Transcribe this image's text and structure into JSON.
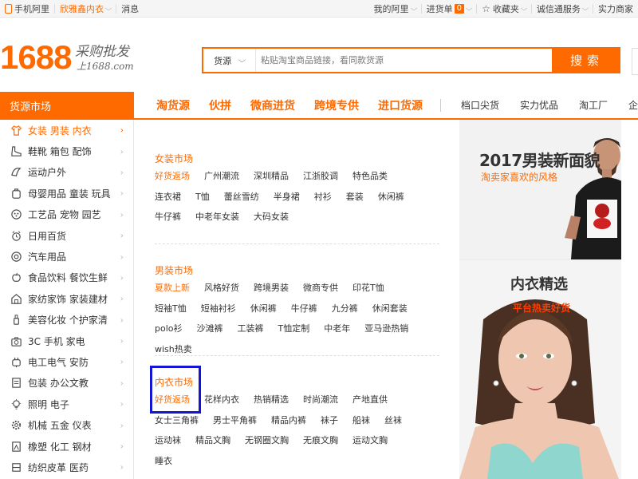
{
  "topbar": {
    "left": [
      {
        "label": "手机阿里",
        "icon": "phone-icon"
      },
      {
        "label": "欣雅鑫内衣",
        "dropdown": true,
        "orange": true
      },
      {
        "label": "消息"
      }
    ],
    "right": [
      {
        "label": "我的阿里",
        "dropdown": true
      },
      {
        "label": "进货单",
        "badge": "0",
        "dropdown": true
      },
      {
        "label": "收藏夹",
        "icon": "star-icon",
        "dropdown": true
      },
      {
        "label": "诚信通服务",
        "dropdown": true
      },
      {
        "label": "实力商家"
      }
    ]
  },
  "logo": {
    "number": "1688",
    "slogan": "采购批发",
    "url": "上1688.com"
  },
  "search": {
    "category": "货源",
    "placeholder": "粘贴淘宝商品链接，看同款货源",
    "button": "搜索"
  },
  "nav": {
    "category_title": "货源市场",
    "hot_links": [
      "淘货源",
      "伙拼",
      "微商进货",
      "跨境专供",
      "进口货源"
    ],
    "plain_links": [
      "档口尖货",
      "实力优品",
      "淘工厂",
      "企"
    ]
  },
  "sidebar": [
    {
      "label": "女装 男装 内衣",
      "icon": "shirt-icon",
      "active": true
    },
    {
      "label": "鞋靴 箱包 配饰",
      "icon": "shoe-icon"
    },
    {
      "label": "运动户外",
      "icon": "sport-icon"
    },
    {
      "label": "母婴用品 童装 玩具",
      "icon": "baby-icon"
    },
    {
      "label": "工艺品 宠物 园艺",
      "icon": "craft-icon"
    },
    {
      "label": "日用百货",
      "icon": "clock-icon"
    },
    {
      "label": "汽车用品",
      "icon": "car-icon"
    },
    {
      "label": "食品饮料 餐饮生鲜",
      "icon": "apple-icon"
    },
    {
      "label": "家纺家饰 家装建材",
      "icon": "home-icon"
    },
    {
      "label": "美容化妆 个护家清",
      "icon": "bottle-icon"
    },
    {
      "label": "3C 手机 家电",
      "icon": "camera-icon"
    },
    {
      "label": "电工电气 安防",
      "icon": "plug-icon"
    },
    {
      "label": "包装 办公文教",
      "icon": "box-icon"
    },
    {
      "label": "照明 电子",
      "icon": "bulb-icon"
    },
    {
      "label": "机械 五金 仪表",
      "icon": "gear-icon"
    },
    {
      "label": "橡塑 化工 钢材",
      "icon": "chemical-icon"
    },
    {
      "label": "纺织皮革 医药",
      "icon": "textile-icon"
    }
  ],
  "markets": [
    {
      "title": "女装市场",
      "tags": [
        {
          "label": "好货返场",
          "hl": true
        },
        {
          "label": "广州潮流"
        },
        {
          "label": "深圳精品"
        },
        {
          "label": "江浙胶调"
        },
        {
          "label": "特色品类"
        },
        {
          "label": "连衣裙"
        },
        {
          "label": "T恤"
        },
        {
          "label": "蕾丝雪纺"
        },
        {
          "label": "半身裙"
        },
        {
          "label": "衬衫"
        },
        {
          "label": "套装"
        },
        {
          "label": "休闲裤"
        },
        {
          "label": "牛仔裤"
        },
        {
          "label": "中老年女装"
        },
        {
          "label": "大码女装"
        }
      ]
    },
    {
      "title": "男装市场",
      "tags": [
        {
          "label": "夏款上新",
          "hl": true
        },
        {
          "label": "风格好货"
        },
        {
          "label": "跨境男装"
        },
        {
          "label": "微商专供"
        },
        {
          "label": "印花T恤"
        },
        {
          "label": "短袖T恤"
        },
        {
          "label": "短袖衬衫"
        },
        {
          "label": "休闲裤"
        },
        {
          "label": "牛仔裤"
        },
        {
          "label": "九分裤"
        },
        {
          "label": "休闲套装"
        },
        {
          "label": "polo衫"
        },
        {
          "label": "沙滩裤"
        },
        {
          "label": "工装裤"
        },
        {
          "label": "T恤定制"
        },
        {
          "label": "中老年"
        },
        {
          "label": "亚马逊热销"
        },
        {
          "label": "wish热卖"
        }
      ]
    },
    {
      "title": "内衣市场",
      "tags": [
        {
          "label": "好货返场",
          "hl": true
        },
        {
          "label": "花样内衣"
        },
        {
          "label": "热销精选"
        },
        {
          "label": "时尚潮流"
        },
        {
          "label": "产地直供"
        },
        {
          "label": "女士三角裤"
        },
        {
          "label": "男士平角裤"
        },
        {
          "label": "精品内裤"
        },
        {
          "label": "袜子"
        },
        {
          "label": "船袜"
        },
        {
          "label": "丝袜"
        },
        {
          "label": "运动袜"
        },
        {
          "label": "精品文胸"
        },
        {
          "label": "无钢圈文胸"
        },
        {
          "label": "无痕文胸"
        },
        {
          "label": "运动文胸"
        },
        {
          "label": "睡衣"
        }
      ]
    }
  ],
  "promo": {
    "p1_title": "2017男装新面貌",
    "p1_sub": "淘卖家喜欢的风格",
    "p2_title": "内衣精选",
    "p2_sub": "平台热卖好货"
  },
  "colors": {
    "accent": "#ff6a00",
    "highlight_box": "#1414d4"
  }
}
